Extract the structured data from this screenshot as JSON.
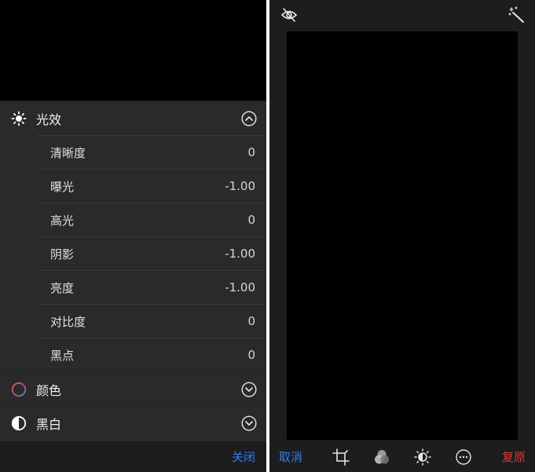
{
  "adjust_panel": {
    "sections": [
      {
        "label": "光效",
        "expanded": true
      },
      {
        "label": "颜色",
        "expanded": false
      },
      {
        "label": "黑白",
        "expanded": false
      }
    ],
    "light_items": [
      {
        "label": "清晰度",
        "value": "0"
      },
      {
        "label": "曝光",
        "value": "-1.00"
      },
      {
        "label": "高光",
        "value": "0"
      },
      {
        "label": "阴影",
        "value": "-1.00"
      },
      {
        "label": "亮度",
        "value": "-1.00"
      },
      {
        "label": "对比度",
        "value": "0"
      },
      {
        "label": "黑点",
        "value": "0"
      }
    ],
    "close_label": "关闭"
  },
  "editor": {
    "cancel_label": "取消",
    "revert_label": "复原",
    "tools": [
      "crop-icon",
      "filters-icon",
      "adjust-icon",
      "more-icon"
    ]
  },
  "colors": {
    "accent_blue": "#2f7ff5",
    "revert_red": "#e5352c",
    "panel_bg": "#2a2a2c"
  }
}
